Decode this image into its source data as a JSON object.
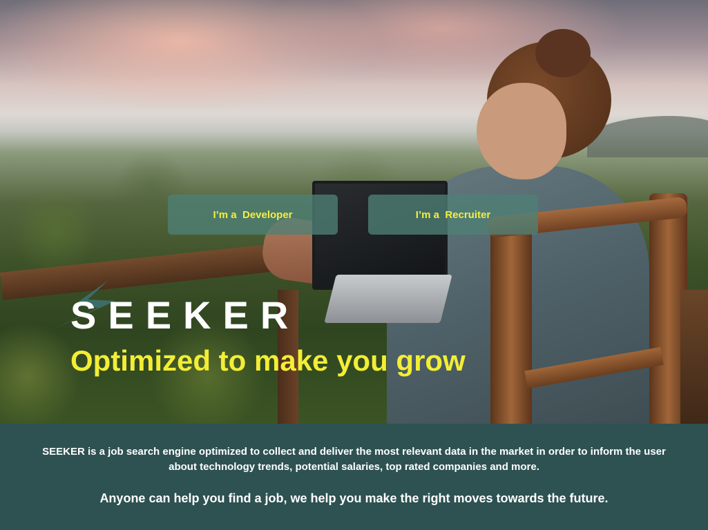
{
  "choices": {
    "developer_label": "I’m a  Developer",
    "recruiter_label": "I’m a  Recruiter"
  },
  "brand": {
    "name": "SEEKER",
    "tagline": "Optimized to make you grow"
  },
  "info": {
    "description": "SEEKER is a job search engine optimized to collect and deliver the most relevant data in the market in order to inform the user about technology trends, potential salaries, top rated companies and more.",
    "motto": "Anyone can help you find a job, we help you make the right moves towards the future."
  },
  "colors": {
    "accent_yellow": "#f3ee35",
    "button_teal": "#4e8076",
    "band_teal": "#2e5152",
    "brand_mark_teal": "#3f6e6a"
  },
  "icons": {
    "brand_mark": "seeker-logo-mark"
  }
}
